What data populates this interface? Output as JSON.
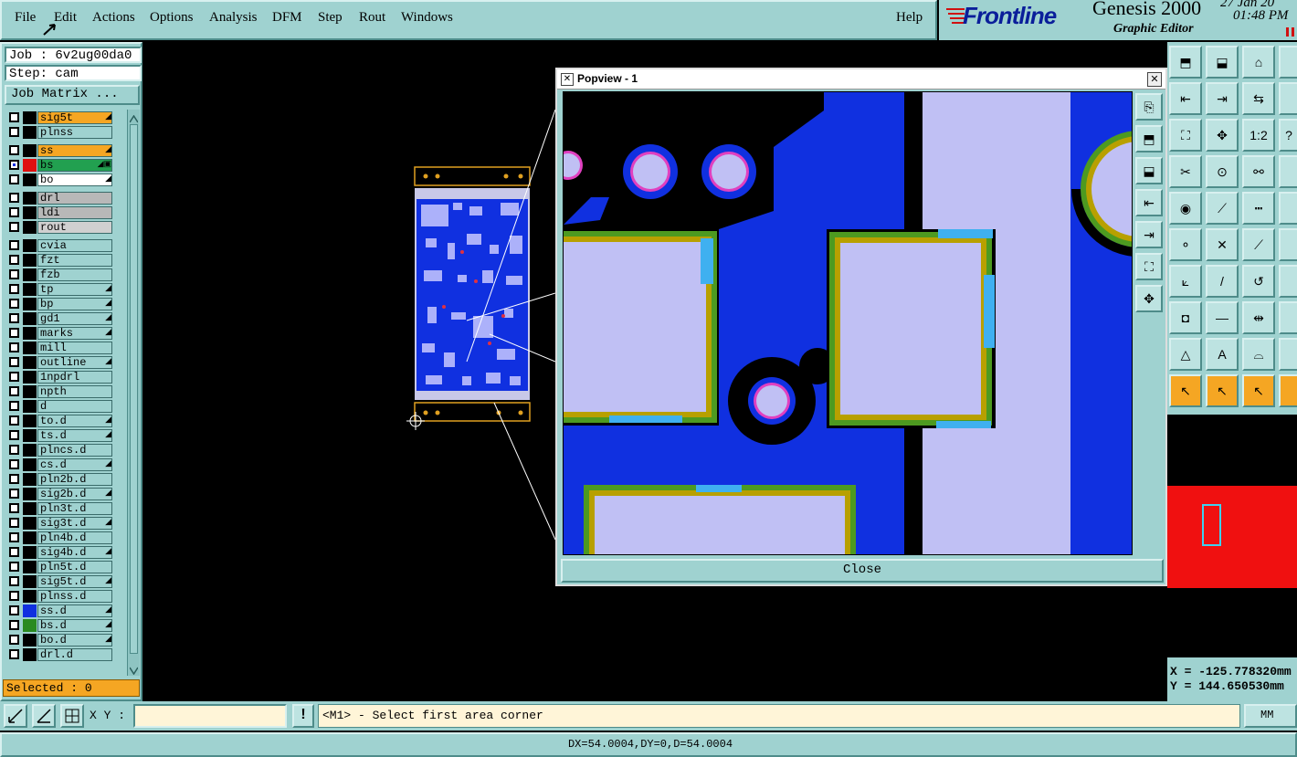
{
  "menubar": {
    "items": [
      "File",
      "Edit",
      "Actions",
      "Options",
      "Analysis",
      "DFM",
      "Step",
      "Rout",
      "Windows"
    ],
    "help": "Help"
  },
  "brand": {
    "logo": "Frontline",
    "product": "Genesis 2000",
    "subtitle": "Graphic Editor",
    "date": "27 Jan 20",
    "time": "01:48 PM"
  },
  "job": {
    "job_label": "Job : 6v2ug00da0",
    "step_label": "Step: cam",
    "matrix_button": "Job Matrix ..."
  },
  "layers": [
    {
      "name": "sig5t",
      "bg": "#f5a623",
      "edit": "◢"
    },
    {
      "name": "plnss",
      "bg": "#9fd2d0",
      "edit": ""
    },
    {
      "name": "ss",
      "bg": "#f5a623",
      "edit": "◢"
    },
    {
      "name": "bs",
      "bg": "#22a050",
      "edit": "◢▣",
      "swatch": "#e01010",
      "active": true
    },
    {
      "name": "bo",
      "bg": "#ffffff",
      "edit": "◢"
    },
    {
      "name": "drl",
      "bg": "#b8b8b8",
      "edit": ""
    },
    {
      "name": "ldi",
      "bg": "#b8b8b8",
      "edit": ""
    },
    {
      "name": "rout",
      "bg": "#d0d0d0",
      "edit": ""
    },
    {
      "name": "cvia",
      "bg": "#9fd2d0",
      "edit": ""
    },
    {
      "name": "fzt",
      "bg": "#9fd2d0",
      "edit": ""
    },
    {
      "name": "fzb",
      "bg": "#9fd2d0",
      "edit": ""
    },
    {
      "name": "tp",
      "bg": "#9fd2d0",
      "edit": "◢"
    },
    {
      "name": "bp",
      "bg": "#9fd2d0",
      "edit": "◢"
    },
    {
      "name": "gd1",
      "bg": "#9fd2d0",
      "edit": "◢"
    },
    {
      "name": "marks",
      "bg": "#9fd2d0",
      "edit": "◢"
    },
    {
      "name": "mill",
      "bg": "#9fd2d0",
      "edit": ""
    },
    {
      "name": "outline",
      "bg": "#9fd2d0",
      "edit": "◢"
    },
    {
      "name": "1npdrl",
      "bg": "#9fd2d0",
      "edit": ""
    },
    {
      "name": "npth",
      "bg": "#9fd2d0",
      "edit": ""
    },
    {
      "name": "d",
      "bg": "#9fd2d0",
      "edit": ""
    },
    {
      "name": "to.d",
      "bg": "#9fd2d0",
      "edit": "◢"
    },
    {
      "name": "ts.d",
      "bg": "#9fd2d0",
      "edit": "◢"
    },
    {
      "name": "plncs.d",
      "bg": "#9fd2d0",
      "edit": ""
    },
    {
      "name": "cs.d",
      "bg": "#9fd2d0",
      "edit": "◢"
    },
    {
      "name": "pln2b.d",
      "bg": "#9fd2d0",
      "edit": ""
    },
    {
      "name": "sig2b.d",
      "bg": "#9fd2d0",
      "edit": "◢"
    },
    {
      "name": "pln3t.d",
      "bg": "#9fd2d0",
      "edit": ""
    },
    {
      "name": "sig3t.d",
      "bg": "#9fd2d0",
      "edit": "◢"
    },
    {
      "name": "pln4b.d",
      "bg": "#9fd2d0",
      "edit": ""
    },
    {
      "name": "sig4b.d",
      "bg": "#9fd2d0",
      "edit": "◢"
    },
    {
      "name": "pln5t.d",
      "bg": "#9fd2d0",
      "edit": ""
    },
    {
      "name": "sig5t.d",
      "bg": "#9fd2d0",
      "edit": "◢"
    },
    {
      "name": "plnss.d",
      "bg": "#9fd2d0",
      "edit": ""
    },
    {
      "name": "ss.d",
      "bg": "#9fd2d0",
      "edit": "◢",
      "swatch": "#1030e0"
    },
    {
      "name": "bs.d",
      "bg": "#9fd2d0",
      "edit": "◢",
      "swatch": "#2a8a20"
    },
    {
      "name": "bo.d",
      "bg": "#9fd2d0",
      "edit": "◢"
    },
    {
      "name": "drl.d",
      "bg": "#9fd2d0",
      "edit": ""
    }
  ],
  "selected": "Selected : 0",
  "popview": {
    "title": "Popview - 1",
    "close_label": "Close"
  },
  "cmd": {
    "xy_label": "X Y :",
    "xy_value": "",
    "prompt": "<M1> - Select first area corner",
    "units": "MM"
  },
  "coords": {
    "x": "X = -125.778320mm",
    "y": "Y = 144.650530mm"
  },
  "status": "DX=54.0004,DY=0,D=54.0004",
  "icons": {
    "right_tools": [
      "layer-up-icon",
      "layer-down-icon",
      "home-icon",
      "extra-icon",
      "zoom-back-icon",
      "zoom-forward-icon",
      "zoom-swap-icon",
      "extra-icon",
      "fit-icon",
      "center-icon",
      "ratio-icon",
      "help-icon",
      "tools-icon",
      "snap-icon",
      "net-icon",
      "extra-icon",
      "pad-icon",
      "line-icon",
      "ruler-icon",
      "extra-icon",
      "net-graph-icon",
      "cross-icon",
      "connect-icon",
      "extra-icon",
      "slope-icon",
      "diag-icon",
      "arc-icon",
      "extra-icon",
      "feature-icon",
      "minus-icon",
      "resize-icon",
      "extra-icon",
      "triangle-icon",
      "a-icon",
      "arch-icon",
      "extra-icon",
      "pointer-icon",
      "select-icon",
      "lasso-icon",
      "extra-icon"
    ],
    "popview_tools": [
      "copy-icon",
      "layer-up-icon",
      "layer-down-icon",
      "zoom-back-icon",
      "zoom-forward-icon",
      "fit-icon",
      "center-icon"
    ]
  }
}
